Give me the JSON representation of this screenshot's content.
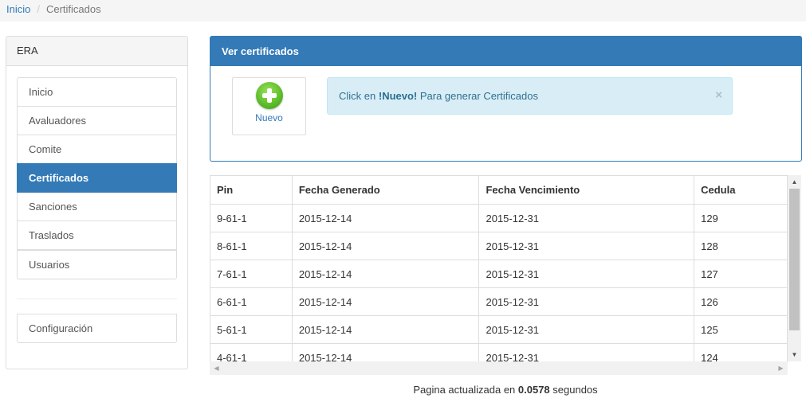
{
  "breadcrumb": {
    "home": "Inicio",
    "separator": "/",
    "current": "Certificados"
  },
  "sidebar": {
    "title": "ERA",
    "items": [
      {
        "label": "Inicio",
        "active": false
      },
      {
        "label": "Avaluadores",
        "active": false
      },
      {
        "label": "Comite",
        "active": false
      },
      {
        "label": "Certificados",
        "active": true
      },
      {
        "label": "Sanciones",
        "active": false
      },
      {
        "label": "Traslados",
        "active": false
      },
      {
        "label": "Usuarios",
        "active": false
      }
    ],
    "config_label": "Configuración"
  },
  "main": {
    "title": "Ver certificados",
    "new_button_label": "Nuevo",
    "alert": {
      "prefix": "Click en ",
      "bold": "!Nuevo!",
      "suffix": " Para generar Certificados",
      "close": "×"
    }
  },
  "table": {
    "headers": [
      "Pin",
      "Fecha Generado",
      "Fecha Vencimiento",
      "Cedula"
    ],
    "rows": [
      [
        "9-61-1",
        "2015-12-14",
        "2015-12-31",
        "129"
      ],
      [
        "8-61-1",
        "2015-12-14",
        "2015-12-31",
        "128"
      ],
      [
        "7-61-1",
        "2015-12-14",
        "2015-12-31",
        "127"
      ],
      [
        "6-61-1",
        "2015-12-14",
        "2015-12-31",
        "126"
      ],
      [
        "5-61-1",
        "2015-12-14",
        "2015-12-31",
        "125"
      ],
      [
        "4-61-1",
        "2015-12-14",
        "2015-12-31",
        "124"
      ]
    ]
  },
  "footer": {
    "prefix": "Pagina actualizada en ",
    "time": "0.0578",
    "suffix": " segundos"
  },
  "colors": {
    "primary": "#337ab7",
    "alert_bg": "#d9edf7",
    "alert_text": "#31708f",
    "plus_green": "#5fbe2c"
  }
}
